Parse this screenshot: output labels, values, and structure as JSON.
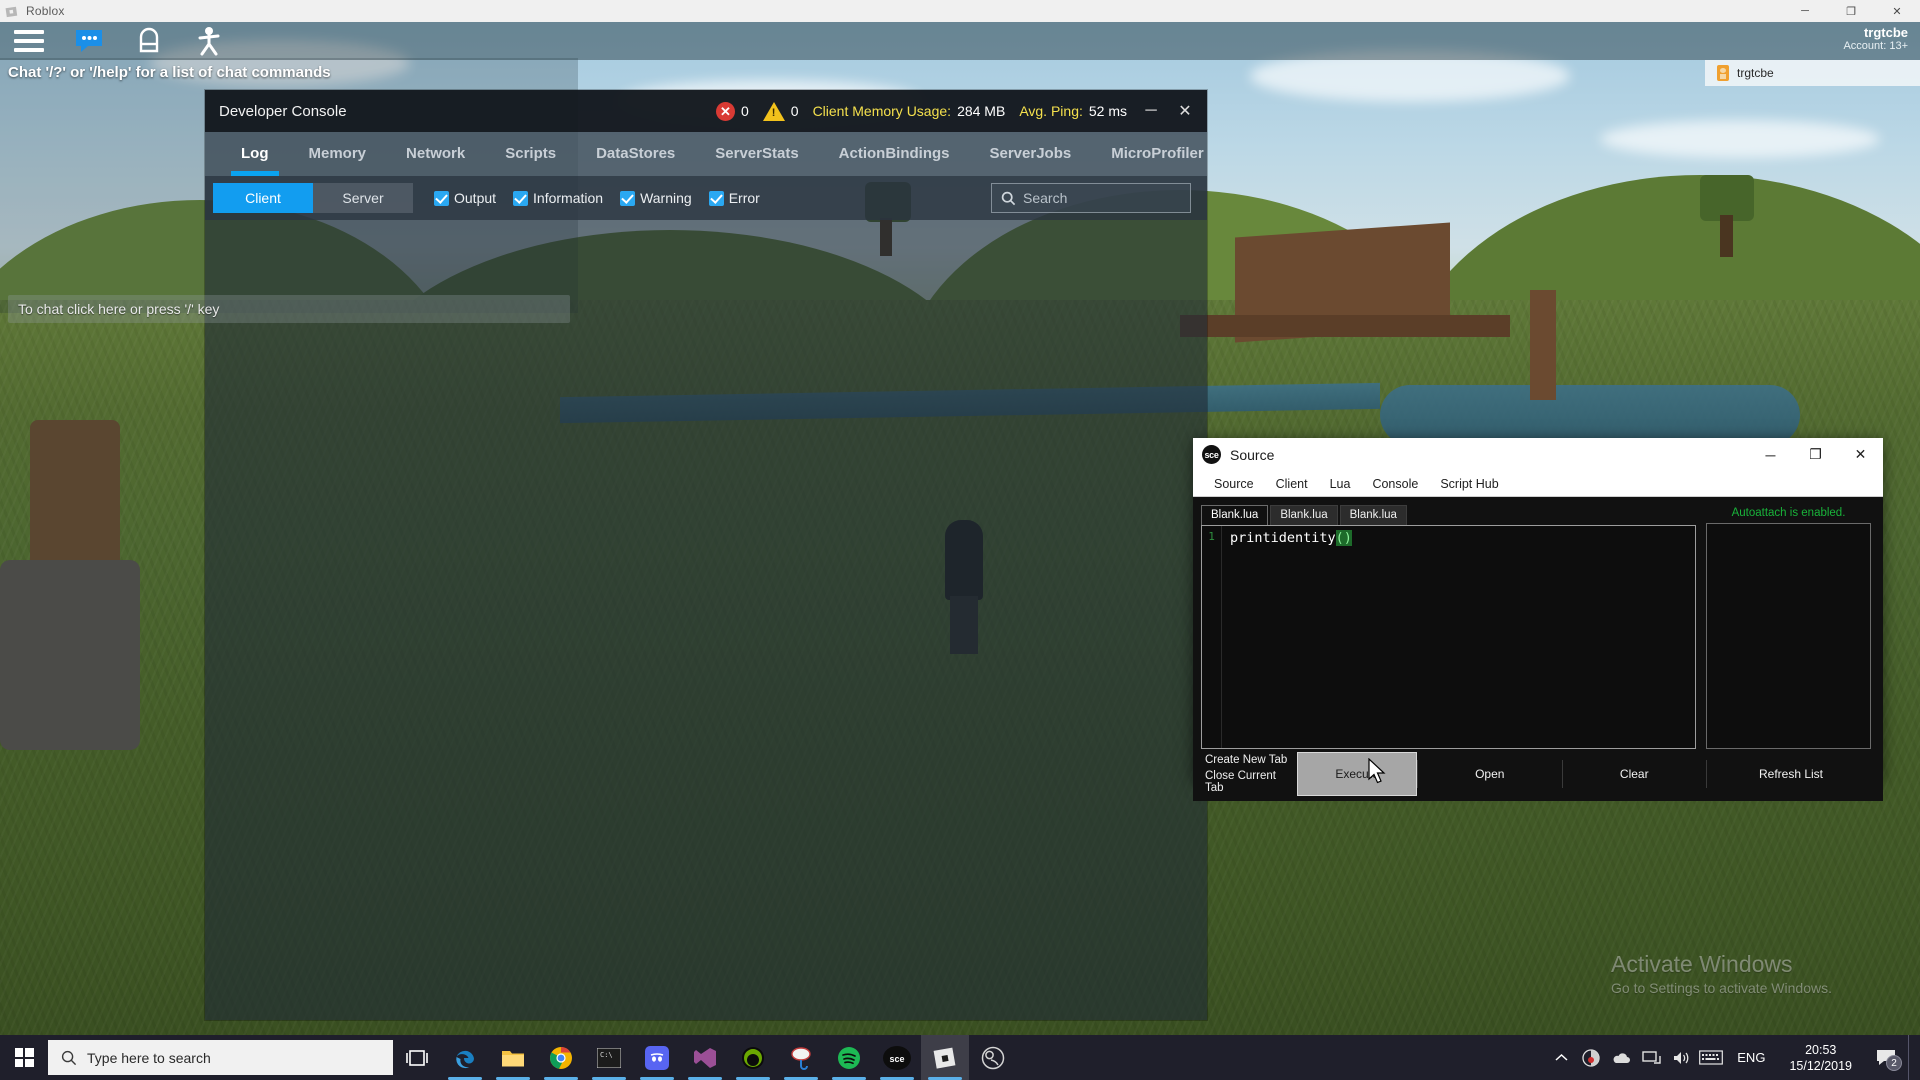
{
  "roblox_window": {
    "title": "Roblox",
    "minimize": "─",
    "maximize": "❐",
    "close": "✕",
    "icons": [
      "roblox-logo-icon"
    ]
  },
  "roblox_topbar": {
    "menu_icon": "hamburger-menu-icon",
    "chat_icon": "chat-bubble-icon",
    "inventory_icon": "backpack-icon",
    "emotes_icon": "emotes-person-icon"
  },
  "chat": {
    "hint": "Chat '/?' or '/help' for a list of chat commands",
    "input_placeholder": "To chat click here or press '/' key"
  },
  "account": {
    "name": "trgtcbe",
    "sub": "Account: 13+",
    "chip_label": "trgtcbe",
    "chip_icon": "age-badge-icon"
  },
  "dev_console": {
    "title": "Developer Console",
    "error_count": "0",
    "warning_count": "0",
    "memory_label": "Client Memory Usage:",
    "memory_value": "284 MB",
    "ping_label": "Avg. Ping:",
    "ping_value": "52 ms",
    "minimize": "─",
    "close": "✕",
    "tabs": [
      {
        "label": "Log",
        "active": true
      },
      {
        "label": "Memory",
        "active": false
      },
      {
        "label": "Network",
        "active": false
      },
      {
        "label": "Scripts",
        "active": false
      },
      {
        "label": "DataStores",
        "active": false
      },
      {
        "label": "ServerStats",
        "active": false
      },
      {
        "label": "ActionBindings",
        "active": false
      },
      {
        "label": "ServerJobs",
        "active": false
      },
      {
        "label": "MicroProfiler",
        "active": false
      }
    ],
    "segments": [
      {
        "label": "Client",
        "active": true
      },
      {
        "label": "Server",
        "active": false
      }
    ],
    "filters": [
      {
        "label": "Output",
        "checked": true
      },
      {
        "label": "Information",
        "checked": true
      },
      {
        "label": "Warning",
        "checked": true
      },
      {
        "label": "Error",
        "checked": true
      }
    ],
    "search_placeholder": "Search",
    "search_icon": "search-icon"
  },
  "source_window": {
    "title": "Source",
    "logo_text": "sce",
    "minimize": "─",
    "maximize": "❐",
    "close": "✕",
    "menu": [
      "Source",
      "Client",
      "Lua",
      "Console",
      "Script Hub"
    ],
    "file_tabs": [
      {
        "label": "Blank.lua",
        "active": true
      },
      {
        "label": "Blank.lua",
        "active": false
      },
      {
        "label": "Blank.lua",
        "active": false
      }
    ],
    "line_number": "1",
    "code_fn": "printidentity",
    "code_paren": "()",
    "attach_status": "Autoattach is enabled.",
    "tab_controls": [
      "Create New Tab",
      "Close Current Tab"
    ],
    "actions": [
      {
        "label": "Execute",
        "pressed": true
      },
      {
        "label": "Open",
        "pressed": false
      },
      {
        "label": "Clear",
        "pressed": false
      }
    ],
    "refresh_label": "Refresh List"
  },
  "watermark": {
    "line1": "Activate Windows",
    "line2": "Go to Settings to activate Windows."
  },
  "taskbar": {
    "start_icon": "windows-start-icon",
    "search_placeholder": "Type here to search",
    "search_icon": "search-icon",
    "taskview_icon": "task-view-icon",
    "apps": [
      {
        "name": "edge-icon",
        "open": true
      },
      {
        "name": "file-explorer-icon",
        "open": true
      },
      {
        "name": "chrome-icon",
        "open": true
      },
      {
        "name": "command-prompt-icon",
        "open": true
      },
      {
        "name": "discord-icon",
        "open": true
      },
      {
        "name": "visual-studio-icon",
        "open": true
      },
      {
        "name": "nvidia-icon",
        "open": true
      },
      {
        "name": "paint-icon",
        "open": true
      },
      {
        "name": "spotify-icon",
        "open": true
      },
      {
        "name": "sce-executor-icon",
        "open": true
      },
      {
        "name": "roblox-icon",
        "open": true
      },
      {
        "name": "obs-icon",
        "open": false
      }
    ],
    "sce_label": "sce",
    "tray": {
      "chevron_icon": "chevron-up-icon",
      "icons": [
        "nvidia-tray-icon",
        "onedrive-icon",
        "network-icon",
        "volume-icon",
        "keyboard-icon"
      ],
      "language": "ENG",
      "time": "20:53",
      "date": "15/12/2019",
      "action_center_icon": "action-center-icon",
      "notification_count": "2"
    }
  }
}
